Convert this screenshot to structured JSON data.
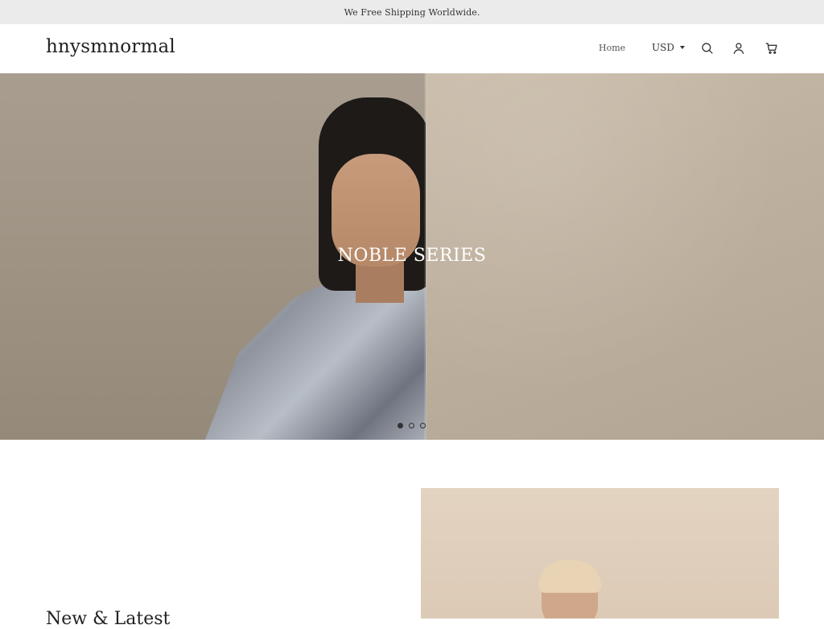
{
  "announcement": {
    "text": "We Free Shipping Worldwide."
  },
  "header": {
    "logo": "hnysmnormal",
    "nav": [
      {
        "label": "Home"
      }
    ],
    "currency": {
      "selected": "USD"
    },
    "icons": [
      "search-icon",
      "account-icon",
      "cart-icon"
    ]
  },
  "hero": {
    "title": "NOBLE SERIES",
    "slides_total": 3,
    "active_slide": 1
  },
  "feature": {
    "heading": "New & Latest"
  },
  "colors": {
    "announcement_bg": "#ebebeb",
    "text": "#222222",
    "hero_title": "#ffffff"
  }
}
